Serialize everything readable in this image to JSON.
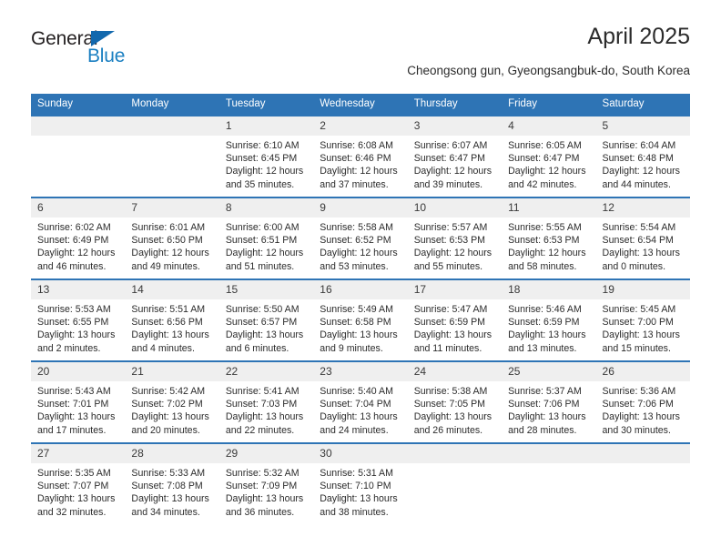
{
  "brand": {
    "name_part1": "General",
    "name_part2": "Blue",
    "triangle_color": "#1268ad",
    "blue_color": "#1a7fc1"
  },
  "header": {
    "title": "April 2025",
    "subtitle": "Cheongsong gun, Gyeongsangbuk-do, South Korea"
  },
  "theme": {
    "header_row_bg": "#2e74b5",
    "day_band_bg": "#efefef",
    "row_divider": "#2e74b5"
  },
  "calendar": {
    "weekday_headers": [
      "Sunday",
      "Monday",
      "Tuesday",
      "Wednesday",
      "Thursday",
      "Friday",
      "Saturday"
    ],
    "weeks": [
      [
        {
          "day": "",
          "empty": true
        },
        {
          "day": "",
          "empty": true
        },
        {
          "day": "1",
          "sunrise": "Sunrise: 6:10 AM",
          "sunset": "Sunset: 6:45 PM",
          "daylight_1": "Daylight: 12 hours",
          "daylight_2": "and 35 minutes."
        },
        {
          "day": "2",
          "sunrise": "Sunrise: 6:08 AM",
          "sunset": "Sunset: 6:46 PM",
          "daylight_1": "Daylight: 12 hours",
          "daylight_2": "and 37 minutes."
        },
        {
          "day": "3",
          "sunrise": "Sunrise: 6:07 AM",
          "sunset": "Sunset: 6:47 PM",
          "daylight_1": "Daylight: 12 hours",
          "daylight_2": "and 39 minutes."
        },
        {
          "day": "4",
          "sunrise": "Sunrise: 6:05 AM",
          "sunset": "Sunset: 6:47 PM",
          "daylight_1": "Daylight: 12 hours",
          "daylight_2": "and 42 minutes."
        },
        {
          "day": "5",
          "sunrise": "Sunrise: 6:04 AM",
          "sunset": "Sunset: 6:48 PM",
          "daylight_1": "Daylight: 12 hours",
          "daylight_2": "and 44 minutes."
        }
      ],
      [
        {
          "day": "6",
          "sunrise": "Sunrise: 6:02 AM",
          "sunset": "Sunset: 6:49 PM",
          "daylight_1": "Daylight: 12 hours",
          "daylight_2": "and 46 minutes."
        },
        {
          "day": "7",
          "sunrise": "Sunrise: 6:01 AM",
          "sunset": "Sunset: 6:50 PM",
          "daylight_1": "Daylight: 12 hours",
          "daylight_2": "and 49 minutes."
        },
        {
          "day": "8",
          "sunrise": "Sunrise: 6:00 AM",
          "sunset": "Sunset: 6:51 PM",
          "daylight_1": "Daylight: 12 hours",
          "daylight_2": "and 51 minutes."
        },
        {
          "day": "9",
          "sunrise": "Sunrise: 5:58 AM",
          "sunset": "Sunset: 6:52 PM",
          "daylight_1": "Daylight: 12 hours",
          "daylight_2": "and 53 minutes."
        },
        {
          "day": "10",
          "sunrise": "Sunrise: 5:57 AM",
          "sunset": "Sunset: 6:53 PM",
          "daylight_1": "Daylight: 12 hours",
          "daylight_2": "and 55 minutes."
        },
        {
          "day": "11",
          "sunrise": "Sunrise: 5:55 AM",
          "sunset": "Sunset: 6:53 PM",
          "daylight_1": "Daylight: 12 hours",
          "daylight_2": "and 58 minutes."
        },
        {
          "day": "12",
          "sunrise": "Sunrise: 5:54 AM",
          "sunset": "Sunset: 6:54 PM",
          "daylight_1": "Daylight: 13 hours",
          "daylight_2": "and 0 minutes."
        }
      ],
      [
        {
          "day": "13",
          "sunrise": "Sunrise: 5:53 AM",
          "sunset": "Sunset: 6:55 PM",
          "daylight_1": "Daylight: 13 hours",
          "daylight_2": "and 2 minutes."
        },
        {
          "day": "14",
          "sunrise": "Sunrise: 5:51 AM",
          "sunset": "Sunset: 6:56 PM",
          "daylight_1": "Daylight: 13 hours",
          "daylight_2": "and 4 minutes."
        },
        {
          "day": "15",
          "sunrise": "Sunrise: 5:50 AM",
          "sunset": "Sunset: 6:57 PM",
          "daylight_1": "Daylight: 13 hours",
          "daylight_2": "and 6 minutes."
        },
        {
          "day": "16",
          "sunrise": "Sunrise: 5:49 AM",
          "sunset": "Sunset: 6:58 PM",
          "daylight_1": "Daylight: 13 hours",
          "daylight_2": "and 9 minutes."
        },
        {
          "day": "17",
          "sunrise": "Sunrise: 5:47 AM",
          "sunset": "Sunset: 6:59 PM",
          "daylight_1": "Daylight: 13 hours",
          "daylight_2": "and 11 minutes."
        },
        {
          "day": "18",
          "sunrise": "Sunrise: 5:46 AM",
          "sunset": "Sunset: 6:59 PM",
          "daylight_1": "Daylight: 13 hours",
          "daylight_2": "and 13 minutes."
        },
        {
          "day": "19",
          "sunrise": "Sunrise: 5:45 AM",
          "sunset": "Sunset: 7:00 PM",
          "daylight_1": "Daylight: 13 hours",
          "daylight_2": "and 15 minutes."
        }
      ],
      [
        {
          "day": "20",
          "sunrise": "Sunrise: 5:43 AM",
          "sunset": "Sunset: 7:01 PM",
          "daylight_1": "Daylight: 13 hours",
          "daylight_2": "and 17 minutes."
        },
        {
          "day": "21",
          "sunrise": "Sunrise: 5:42 AM",
          "sunset": "Sunset: 7:02 PM",
          "daylight_1": "Daylight: 13 hours",
          "daylight_2": "and 20 minutes."
        },
        {
          "day": "22",
          "sunrise": "Sunrise: 5:41 AM",
          "sunset": "Sunset: 7:03 PM",
          "daylight_1": "Daylight: 13 hours",
          "daylight_2": "and 22 minutes."
        },
        {
          "day": "23",
          "sunrise": "Sunrise: 5:40 AM",
          "sunset": "Sunset: 7:04 PM",
          "daylight_1": "Daylight: 13 hours",
          "daylight_2": "and 24 minutes."
        },
        {
          "day": "24",
          "sunrise": "Sunrise: 5:38 AM",
          "sunset": "Sunset: 7:05 PM",
          "daylight_1": "Daylight: 13 hours",
          "daylight_2": "and 26 minutes."
        },
        {
          "day": "25",
          "sunrise": "Sunrise: 5:37 AM",
          "sunset": "Sunset: 7:06 PM",
          "daylight_1": "Daylight: 13 hours",
          "daylight_2": "and 28 minutes."
        },
        {
          "day": "26",
          "sunrise": "Sunrise: 5:36 AM",
          "sunset": "Sunset: 7:06 PM",
          "daylight_1": "Daylight: 13 hours",
          "daylight_2": "and 30 minutes."
        }
      ],
      [
        {
          "day": "27",
          "sunrise": "Sunrise: 5:35 AM",
          "sunset": "Sunset: 7:07 PM",
          "daylight_1": "Daylight: 13 hours",
          "daylight_2": "and 32 minutes."
        },
        {
          "day": "28",
          "sunrise": "Sunrise: 5:33 AM",
          "sunset": "Sunset: 7:08 PM",
          "daylight_1": "Daylight: 13 hours",
          "daylight_2": "and 34 minutes."
        },
        {
          "day": "29",
          "sunrise": "Sunrise: 5:32 AM",
          "sunset": "Sunset: 7:09 PM",
          "daylight_1": "Daylight: 13 hours",
          "daylight_2": "and 36 minutes."
        },
        {
          "day": "30",
          "sunrise": "Sunrise: 5:31 AM",
          "sunset": "Sunset: 7:10 PM",
          "daylight_1": "Daylight: 13 hours",
          "daylight_2": "and 38 minutes."
        },
        {
          "day": "",
          "empty": true
        },
        {
          "day": "",
          "empty": true
        },
        {
          "day": "",
          "empty": true
        }
      ]
    ]
  }
}
